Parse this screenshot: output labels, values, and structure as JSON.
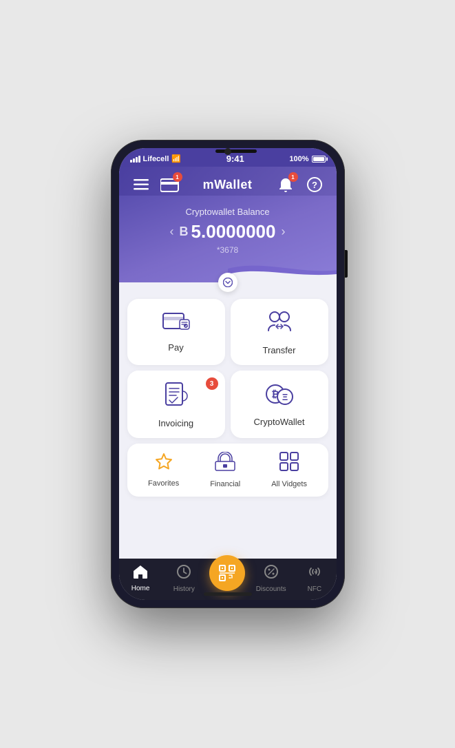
{
  "phone": {
    "status": {
      "carrier": "Lifecell",
      "time": "9:41",
      "battery": "100%"
    },
    "header": {
      "title": "mWallet",
      "notification_badge": "1"
    },
    "balance": {
      "label": "Cryptowallet Balance",
      "currency_symbol": "B",
      "amount": "5.0000000",
      "account": "*3678"
    },
    "cards": [
      {
        "id": "pay",
        "label": "Pay",
        "badge": null
      },
      {
        "id": "transfer",
        "label": "Transfer",
        "badge": null
      },
      {
        "id": "invoicing",
        "label": "Invoicing",
        "badge": "3"
      },
      {
        "id": "cryptowallet",
        "label": "CryptoWallet",
        "badge": null
      }
    ],
    "widgets": [
      {
        "id": "favorites",
        "label": "Favorites",
        "color": "orange"
      },
      {
        "id": "financial",
        "label": "Financial",
        "color": "purple"
      },
      {
        "id": "all-vidgets",
        "label": "All Vidgets",
        "color": "purple"
      }
    ],
    "nav": [
      {
        "id": "home",
        "label": "Home",
        "active": true
      },
      {
        "id": "history",
        "label": "History",
        "active": false
      },
      {
        "id": "scan",
        "label": "",
        "active": false,
        "center": true
      },
      {
        "id": "discounts",
        "label": "Discounts",
        "active": false
      },
      {
        "id": "nfc",
        "label": "NFC",
        "active": false
      }
    ]
  }
}
